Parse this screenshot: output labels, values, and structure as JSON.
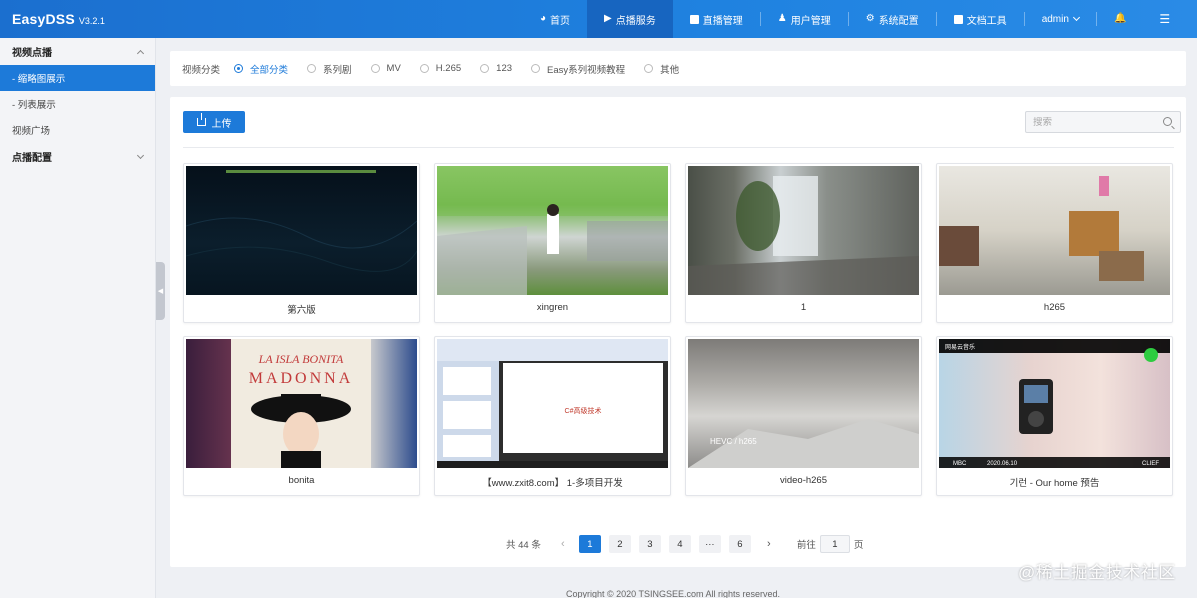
{
  "app": {
    "name": "EasyDSS",
    "version": "V3.2.1"
  },
  "nav": {
    "items": [
      {
        "label": "首页",
        "icon": "dashboard-icon",
        "active": false
      },
      {
        "label": "点播服务",
        "icon": "video-camera-icon",
        "active": true
      },
      {
        "label": "直播管理",
        "icon": "live-icon",
        "active": false
      },
      {
        "label": "用户管理",
        "icon": "user-icon",
        "active": false
      },
      {
        "label": "系统配置",
        "icon": "gear-icon",
        "active": false
      },
      {
        "label": "文档工具",
        "icon": "document-icon",
        "active": false
      }
    ],
    "user": "admin"
  },
  "sidebar": {
    "group1": "视频点播",
    "items": [
      {
        "label": "- 缩略图展示",
        "active": true
      },
      {
        "label": "- 列表展示",
        "active": false
      }
    ],
    "plaza": "视频广场",
    "group2": "点播配置"
  },
  "filter": {
    "label": "视频分类",
    "options": [
      "全部分类",
      "系列剧",
      "MV",
      "H.265",
      "123",
      "Easy系列视频教程",
      "其他"
    ],
    "selected": "全部分类"
  },
  "toolbar": {
    "upload_label": "上传",
    "search_placeholder": "搜索"
  },
  "videos": [
    {
      "title": "第六版"
    },
    {
      "title": "xingren"
    },
    {
      "title": "1"
    },
    {
      "title": "h265"
    },
    {
      "title": "bonita"
    },
    {
      "title": "【www.zxit8.com】 1-多项目开发"
    },
    {
      "title": "video-h265"
    },
    {
      "title": "기런 - Our home 预告"
    }
  ],
  "pagination": {
    "total_text": "共 44 条",
    "pages": [
      "1",
      "2",
      "3",
      "4",
      "···",
      "6"
    ],
    "current": "1",
    "goto_prefix": "前往",
    "goto_value": "1",
    "goto_suffix": "页"
  },
  "footer": "Copyright © 2020 TSINGSEE.com All rights reserved.",
  "watermark": "@稀土掘金技术社区",
  "thumb_text": {
    "album_title": "LA ISLA BONITA",
    "album_artist": "MADONNA",
    "ppt_text": "C#高级技术",
    "cloud_text": "HEVC / h265",
    "music_logo": "网易云音乐",
    "music_badge": "MBC",
    "music_date": "2020.06.10",
    "music_corner": "CLIEF"
  },
  "colors": {
    "primary": "#1d7ad9",
    "header": "#1f82e0"
  }
}
